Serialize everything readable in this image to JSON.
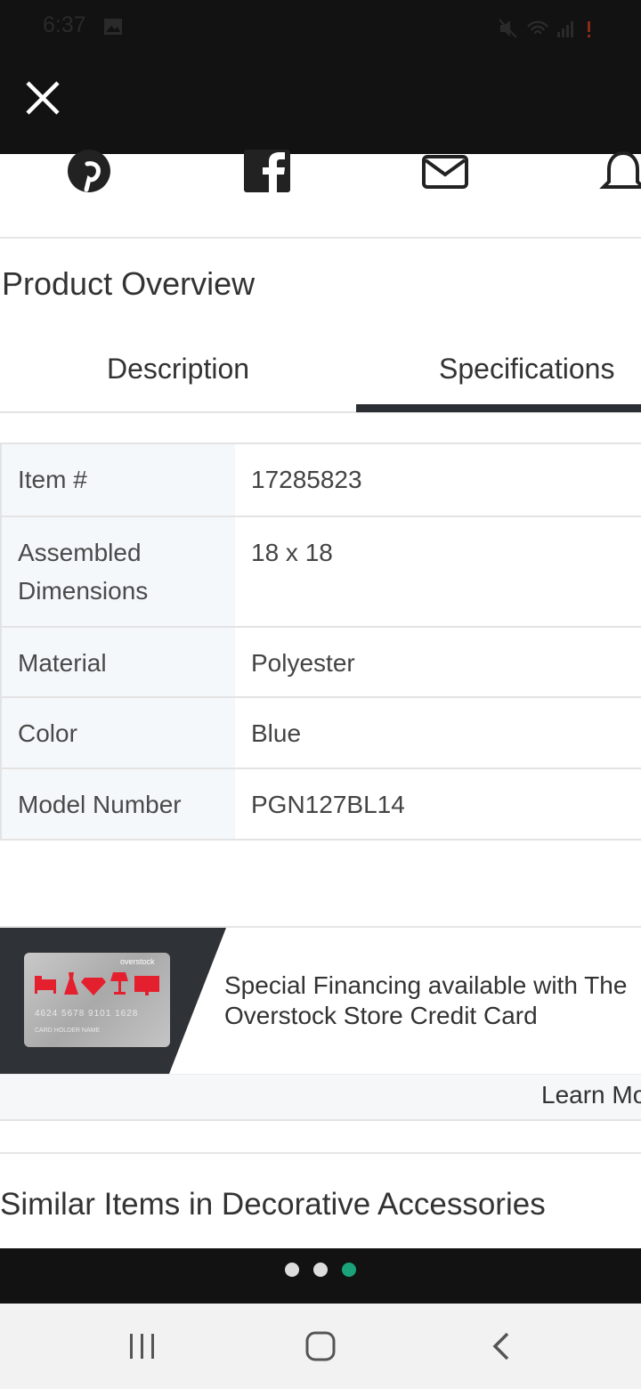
{
  "status_bar": {
    "time": "6:37",
    "image_icon": "image-icon",
    "icons": [
      "mute-icon",
      "wifi-icon",
      "signal-icon",
      "alert-icon"
    ]
  },
  "header": {
    "close_icon": "close-icon"
  },
  "share": {
    "icons": [
      "pinterest-icon",
      "facebook-icon",
      "email-icon",
      "bell-icon"
    ]
  },
  "product_overview": {
    "title": "Product Overview",
    "tabs": [
      {
        "label": "Description",
        "active": false
      },
      {
        "label": "Specifications",
        "active": true
      }
    ],
    "specifications": [
      {
        "label": "Item #",
        "value": "17285823"
      },
      {
        "label": "Assembled Dimensions",
        "value": "18 x 18"
      },
      {
        "label": "Material",
        "value": "Polyester"
      },
      {
        "label": "Color",
        "value": "Blue"
      },
      {
        "label": "Model Number",
        "value": "PGN127BL14"
      }
    ]
  },
  "financing": {
    "text": "Special Financing available with The Overstock Store Credit Card",
    "card_brand": "overstock",
    "card_number": "4624 5678 9101 1628",
    "card_holder": "CARD HOLDER NAME",
    "learn_more": "Learn More",
    "card_icons": [
      "bed-icon",
      "dress-icon",
      "diamond-icon",
      "lamp-icon",
      "tv-icon"
    ]
  },
  "similar": {
    "title": "Similar Items in Decorative Accessories"
  },
  "carousel": {
    "count": 3,
    "active_index": 2
  },
  "colors": {
    "accent_green": "#1aa37a",
    "dark_bar": "#121212",
    "card_red": "#e5202e",
    "tab_underline": "#2b2f33"
  },
  "nav_bar": {
    "icons": [
      "recent-apps-icon",
      "home-icon",
      "back-icon"
    ]
  }
}
